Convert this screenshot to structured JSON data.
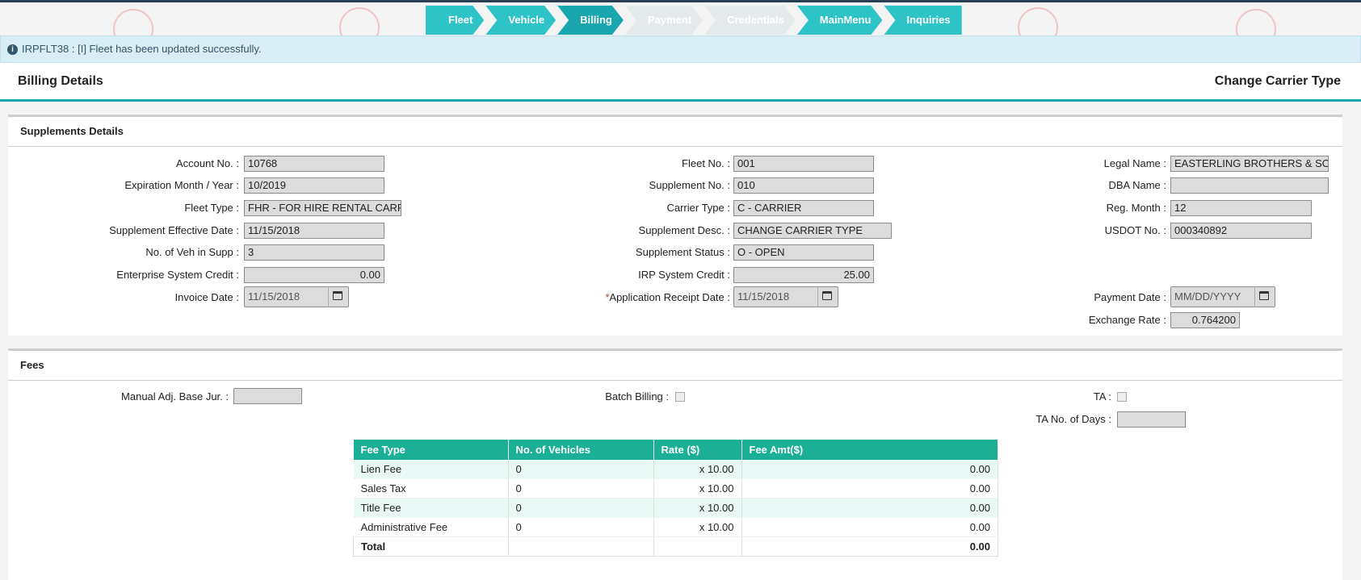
{
  "steps": [
    {
      "label": "Fleet",
      "state": "done"
    },
    {
      "label": "Vehicle",
      "state": "done"
    },
    {
      "label": "Billing",
      "state": "active"
    },
    {
      "label": "Payment",
      "state": "disabled"
    },
    {
      "label": "Credentials",
      "state": "disabled"
    },
    {
      "label": "MainMenu",
      "state": "done"
    },
    {
      "label": "Inquiries",
      "state": "done"
    }
  ],
  "alert": {
    "message": "IRPFLT38 : [I] Fleet has been updated successfully."
  },
  "header": {
    "title": "Billing Details",
    "right": "Change Carrier Type"
  },
  "supplements": {
    "title": "Supplements Details",
    "account_no": {
      "label": "Account No. :",
      "value": "10768"
    },
    "exp_month_year": {
      "label": "Expiration Month / Year :",
      "value": "10/2019"
    },
    "fleet_type": {
      "label": "Fleet Type :",
      "value": "FHR - FOR HIRE RENTAL CARRIER"
    },
    "supp_eff_date": {
      "label": "Supplement Effective Date :",
      "value": "11/15/2018"
    },
    "no_veh_supp": {
      "label": "No. of Veh in Supp :",
      "value": "3"
    },
    "enterprise_credit": {
      "label": "Enterprise System Credit :",
      "value": "0.00"
    },
    "invoice_date": {
      "label": "Invoice Date :",
      "value": "11/15/2018"
    },
    "fleet_no": {
      "label": "Fleet No. :",
      "value": "001"
    },
    "supplement_no": {
      "label": "Supplement No. :",
      "value": "010"
    },
    "carrier_type": {
      "label": "Carrier Type :",
      "value": "C - CARRIER"
    },
    "supp_desc": {
      "label": "Supplement Desc. :",
      "value": "CHANGE CARRIER TYPE"
    },
    "supp_status": {
      "label": "Supplement Status :",
      "value": "O - OPEN"
    },
    "irp_credit": {
      "label": "IRP System Credit :",
      "value": "25.00"
    },
    "app_receipt_date": {
      "required": "*",
      "label": "Application Receipt Date :",
      "value": "11/15/2018"
    },
    "legal_name": {
      "label": "Legal Name :",
      "value": "EASTERLING BROTHERS & SONS"
    },
    "dba_name": {
      "label": "DBA Name :",
      "value": ""
    },
    "reg_month": {
      "label": "Reg. Month :",
      "value": "12"
    },
    "usdot_no": {
      "label": "USDOT No. :",
      "value": "000340892"
    },
    "payment_date": {
      "label": "Payment Date :",
      "placeholder": "MM/DD/YYYY"
    },
    "exchange_rate": {
      "label": "Exchange Rate :",
      "value": "0.764200"
    }
  },
  "fees": {
    "title": "Fees",
    "manual_adj": {
      "label": "Manual Adj. Base Jur. :",
      "value": ""
    },
    "batch_billing": {
      "label": "Batch Billing :"
    },
    "ta": {
      "label": "TA :"
    },
    "ta_days": {
      "label": "TA No. of Days :",
      "value": ""
    },
    "table": {
      "headers": [
        "Fee Type",
        "No. of Vehicles",
        "Rate ($)",
        "Fee Amt($)"
      ],
      "rows": [
        {
          "type": "Lien Fee",
          "vehicles": "0",
          "rate": "x 10.00",
          "amt": "0.00"
        },
        {
          "type": "Sales Tax",
          "vehicles": "0",
          "rate": "x 10.00",
          "amt": "0.00"
        },
        {
          "type": "Title Fee",
          "vehicles": "0",
          "rate": "x 10.00",
          "amt": "0.00"
        },
        {
          "type": "Administrative Fee",
          "vehicles": "0",
          "rate": "x 10.00",
          "amt": "0.00"
        }
      ],
      "total": {
        "label": "Total",
        "amt": "0.00"
      }
    }
  }
}
